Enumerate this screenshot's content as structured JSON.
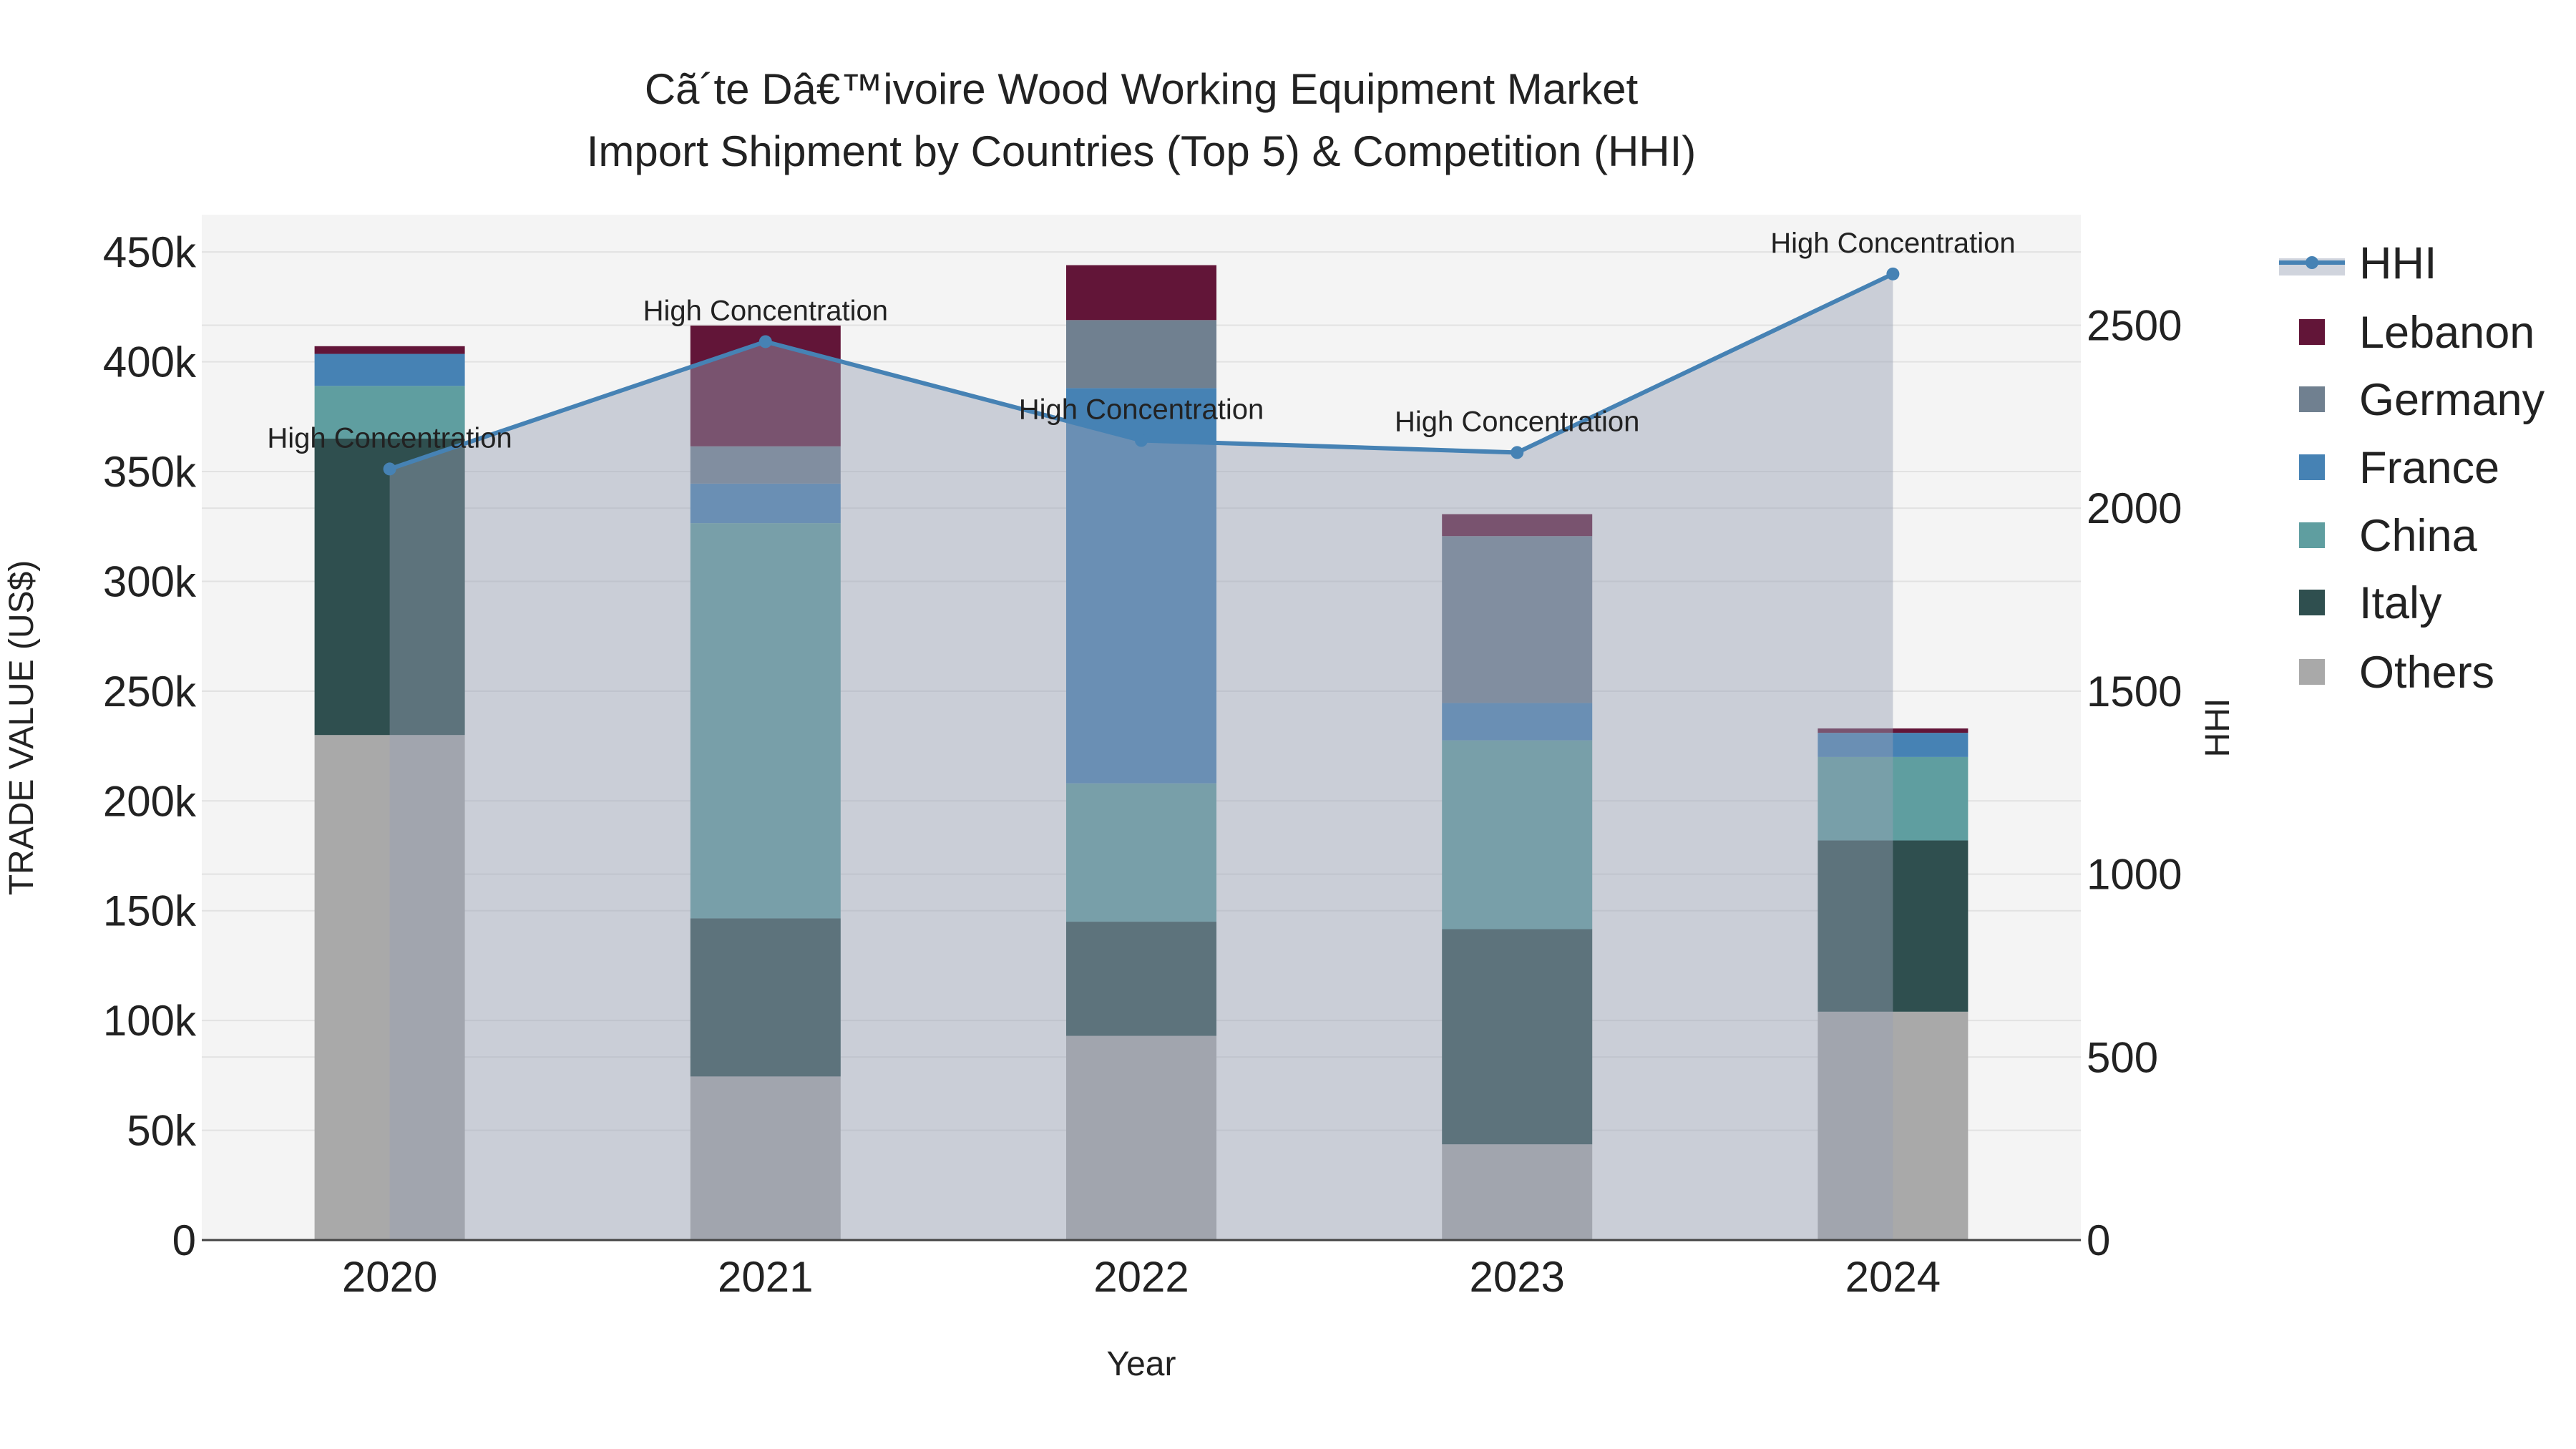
{
  "chart_data": {
    "type": "bar",
    "stacked": true,
    "title": "Cã´te Dâ€™ivoire Wood Working Equipment Market",
    "subtitle": "Import Shipment by Countries (Top 5) & Competition (HHI)",
    "xlabel": "Year",
    "ylabel": "TRADE VALUE (US$)",
    "y2label": "HHI",
    "categories": [
      "2020",
      "2021",
      "2022",
      "2023",
      "2024"
    ],
    "ylim": [
      0,
      467000
    ],
    "y2lim": [
      0,
      2802
    ],
    "yticks": [
      0,
      50000,
      100000,
      150000,
      200000,
      250000,
      300000,
      350000,
      400000,
      450000
    ],
    "ytick_labels": [
      "0",
      "50k",
      "100k",
      "150k",
      "200k",
      "250k",
      "300k",
      "350k",
      "400k",
      "450k"
    ],
    "y2ticks": [
      0,
      500,
      1000,
      1500,
      2000,
      2500
    ],
    "y2tick_labels": [
      "0",
      "500",
      "1000",
      "1500",
      "2000",
      "2500"
    ],
    "grid": true,
    "legend_position": "right",
    "series": [
      {
        "name": "Others",
        "color": "#a9a9a9",
        "values": [
          230000,
          74500,
          93000,
          43600,
          104000
        ]
      },
      {
        "name": "Italy",
        "color": "#2f4f4f",
        "values": [
          135000,
          72000,
          52000,
          98000,
          78000
        ]
      },
      {
        "name": "China",
        "color": "#5f9ea0",
        "values": [
          24000,
          180000,
          63000,
          86000,
          38000
        ]
      },
      {
        "name": "France",
        "color": "#4682b4",
        "values": [
          14600,
          18000,
          180000,
          17000,
          11000
        ]
      },
      {
        "name": "Germany",
        "color": "#708090",
        "values": [
          0,
          17000,
          31000,
          76000,
          0
        ]
      },
      {
        "name": "Lebanon",
        "color": "#621538",
        "values": [
          3500,
          55000,
          25000,
          10000,
          2000
        ]
      }
    ],
    "line": {
      "name": "HHI",
      "color": "#4682b4",
      "axis": "y2",
      "values": [
        2107,
        2455,
        2185,
        2152,
        2640
      ]
    },
    "annotations": [
      "High Concentration",
      "High Concentration",
      "High Concentration",
      "High Concentration",
      "High Concentration"
    ],
    "legend_order": [
      "HHI",
      "Lebanon",
      "Germany",
      "France",
      "China",
      "Italy",
      "Others"
    ]
  }
}
